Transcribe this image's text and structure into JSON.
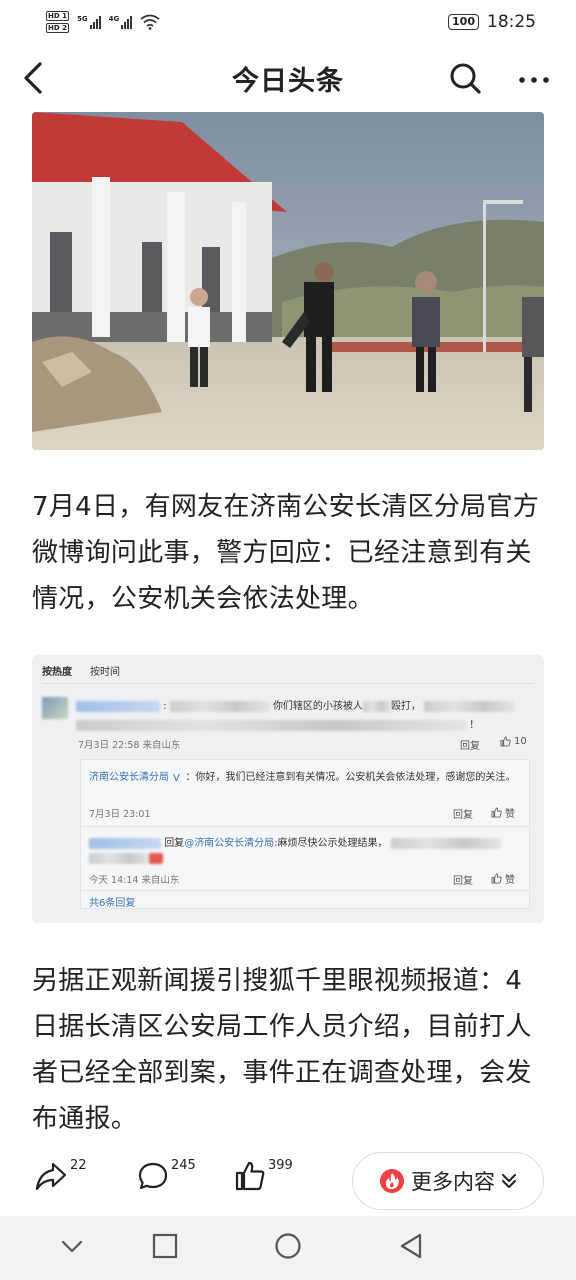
{
  "status_bar": {
    "hd1": "HD 1",
    "hd2": "HD 2",
    "sig1": "5G",
    "sig2": "4G",
    "battery": "100",
    "time": "18:25"
  },
  "nav": {
    "title": "今日头条"
  },
  "article": {
    "para1": "7月4日，有网友在济南公安长清区分局官方微博询问此事，警方回应：已经注意到有关情况，公安机关会依法处理。",
    "para2": "另据正观新闻援引搜狐千里眼视频报道：4日据长清区公安局工作人员介绍，目前打人者已经全部到案，事件正在调查处理，会发布通报。"
  },
  "weibo": {
    "tab_hot": "按热度",
    "tab_time": "按时间",
    "comment1_text_a": "你们辖区的小孩被人",
    "comment1_text_b": "殴打，",
    "comment1_end": "！",
    "comment1_meta": "7月3日 22:58 来自山东",
    "comment1_reply": "回复",
    "comment1_likes": "10",
    "police_name": "济南公安长清分局",
    "police_text": "：你好，我们已经注意到有关情况。公安机关会依法处理，感谢您的关注。",
    "police_meta": "7月3日 23:01",
    "reply_label": "回复",
    "like_label": "赞",
    "reply2_prefix": "回复",
    "reply2_mention": "@济南公安长清分局",
    "reply2_text": ":麻烦尽快公示处理结果，",
    "reply2_meta": "今天 14:14 来自山东",
    "total_replies": "共6条回复"
  },
  "actions": {
    "share_count": "22",
    "comment_count": "245",
    "like_count": "399",
    "more_label": "更多内容"
  },
  "colors": {
    "accent_red": "#f04142",
    "link_blue": "#3b6fb6"
  }
}
